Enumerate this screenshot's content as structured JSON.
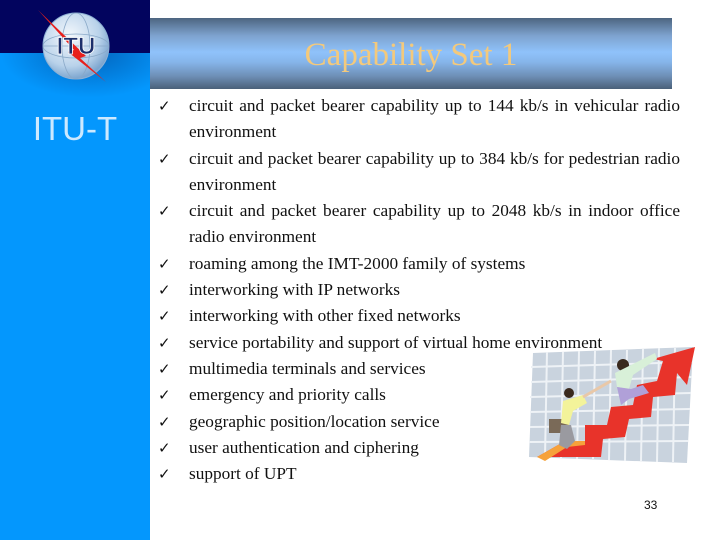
{
  "sidebar": {
    "logo_text": "ITU",
    "label": "ITU-T",
    "colors": {
      "top_band": "#02045e",
      "panel": "#0497fd"
    }
  },
  "slide": {
    "title": "Capability Set 1",
    "title_color": "#f3c97c",
    "bullet_icon": "checkmark-icon",
    "bullets": [
      {
        "text": "circuit and packet bearer capability up to 144 kb/s in vehicular radio environment"
      },
      {
        "text": "circuit and packet bearer capability up to 384 kb/s for pedestrian radio environment"
      },
      {
        "text": "circuit and packet bearer capability up to 2048 kb/s in indoor office radio environment"
      },
      {
        "text": "roaming among the IMT-2000 family of systems"
      },
      {
        "text": "interworking with IP networks"
      },
      {
        "text": "interworking with other fixed networks"
      },
      {
        "text": "service portability and support of virtual home environment"
      },
      {
        "text": "multimedia terminals and services"
      },
      {
        "text": "emergency and priority calls"
      },
      {
        "text": "geographic position/location service"
      },
      {
        "text": "user authentication and ciphering"
      },
      {
        "text": "support of UPT"
      }
    ],
    "check_glyph": "✓",
    "page_number": "33"
  }
}
